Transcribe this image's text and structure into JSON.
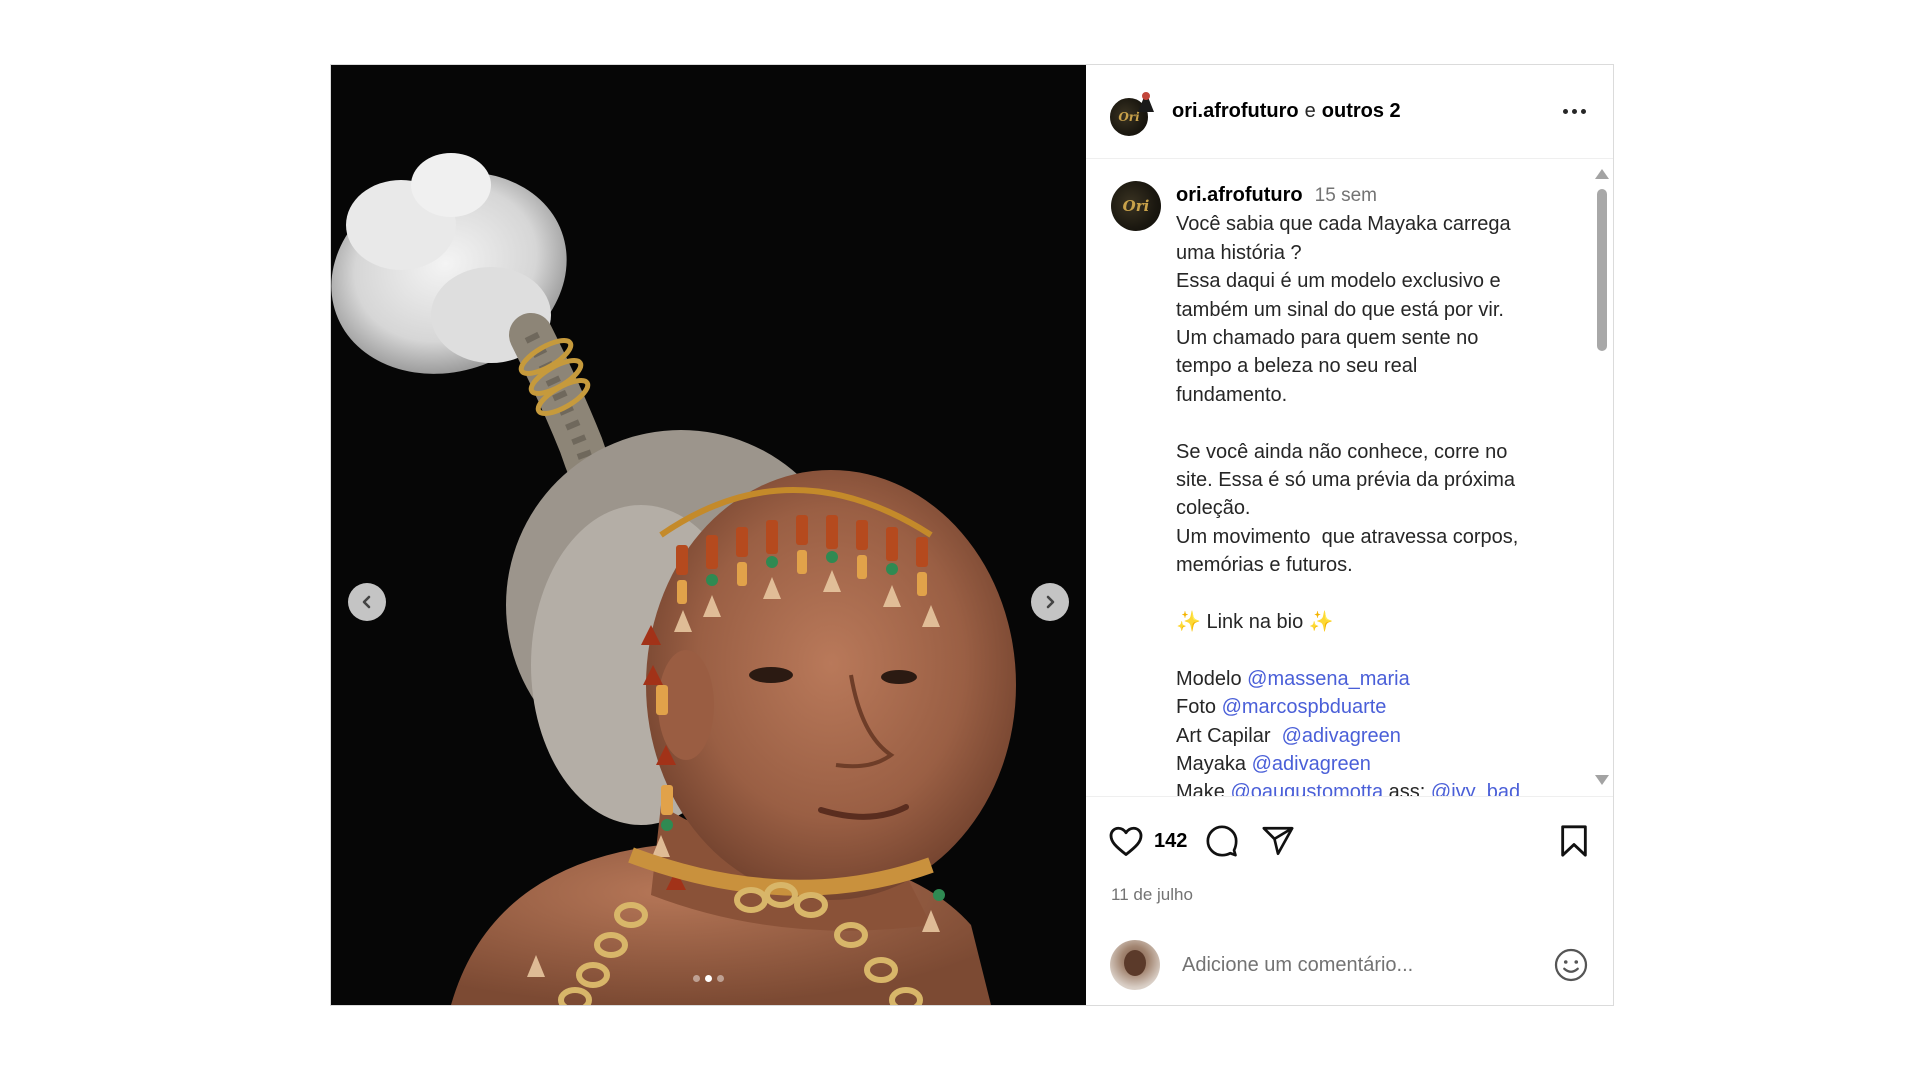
{
  "media": {
    "prev_label": "Previous",
    "next_label": "Next",
    "slides_total": 3,
    "active_slide": 2
  },
  "header": {
    "username": "ori.afrofuturo",
    "connector": "e",
    "others": "outros 2",
    "avatar_text": "Ori"
  },
  "caption": {
    "username": "ori.afrofuturo",
    "time_ago": "15 sem",
    "lines": [
      "Você sabia que cada Mayaka carrega",
      "uma história ?",
      "Essa daqui é um modelo exclusivo e",
      "também um sinal do que está por vir.",
      "Um chamado para quem sente no",
      "tempo a beleza no seu real",
      "fundamento.",
      "",
      "Se você ainda não conhece, corre no",
      "site. Essa é só uma prévia da próxima",
      "coleção.",
      "Um movimento  que atravessa corpos,",
      "memórias e futuros.",
      "",
      "✨ Link na bio ✨",
      ""
    ],
    "credits": [
      {
        "label": "Modelo ",
        "mention": "@massena_maria"
      },
      {
        "label": "Foto ",
        "mention": "@marcospbduarte"
      },
      {
        "label": "Art Capilar  ",
        "mention": "@adivagreen"
      },
      {
        "label": "Mayaka ",
        "mention": "@adivagreen"
      },
      {
        "label": "Make ",
        "mention": "@oaugustomotta",
        "extra": " ass: ",
        "mention2": "@ivy_bad"
      }
    ]
  },
  "actions": {
    "likes": "142",
    "date": "11 de julho"
  },
  "comment": {
    "placeholder": "Adicione um comentário..."
  },
  "colors": {
    "mention": "#4a5fd8",
    "muted": "#737373",
    "border": "#dbdbdb"
  },
  "icons": [
    "chevron-left-icon",
    "chevron-right-icon",
    "more-icon",
    "heart-icon",
    "comment-icon",
    "share-icon",
    "bookmark-icon",
    "emoji-icon"
  ]
}
